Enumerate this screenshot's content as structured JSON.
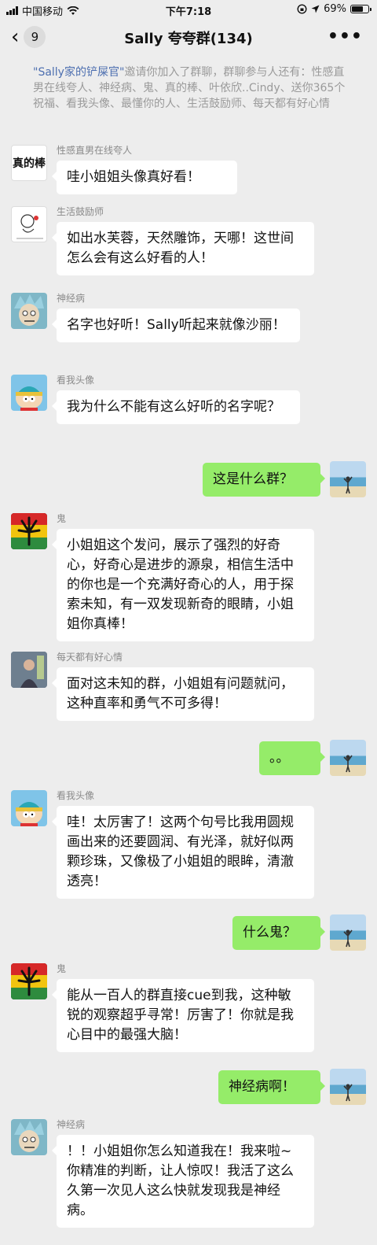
{
  "status_bar": {
    "carrier": "中国移动",
    "time": "下午7:18",
    "battery": "69%",
    "battery_level": 0.69
  },
  "nav": {
    "unread_count": "9",
    "title": "Sally 夸夸群(134)",
    "more": "•••"
  },
  "system_message": {
    "inviter": "\"Sally家的铲屎官\"",
    "text": "邀请你加入了群聊，群聊参与人还有：性感直男在线夸人、神经病、鬼、真的棒、叶依欣..Cindy、送你365个祝福、看我头像、最懂你的人、生活鼓励师、每天都有好心情"
  },
  "messages": [
    {
      "dir": "in",
      "sender": "性感直男在线夸人",
      "text": "哇小姐姐头像真好看！",
      "avatar": "true-bang-avatar",
      "avatar_text": "真的棒"
    },
    {
      "dir": "in",
      "sender": "生活鼓励师",
      "text": "如出水芙蓉，天然雕饰，天哪！这世间怎么会有这么好看的人！",
      "avatar": "sketch-avatar"
    },
    {
      "dir": "in",
      "sender": "神经病",
      "text": "名字也好听！Sally听起来就像沙丽！",
      "avatar": "rick-avatar"
    },
    {
      "dir": "in",
      "sender": "看我头像",
      "text": "我为什么不能有这么好听的名字呢？",
      "avatar": "cartman-avatar"
    },
    {
      "dir": "out",
      "text": "这是什么群？",
      "avatar": "beach-avatar"
    },
    {
      "dir": "in",
      "sender": "鬼",
      "text": "小姐姐这个发问，展示了强烈的好奇心，好奇心是进步的源泉，相信生活中的你也是一个充满好奇心的人，用于探索未知，有一双发现新奇的眼睛，小姐姐你真棒！",
      "avatar": "weed-avatar"
    },
    {
      "dir": "in",
      "sender": "每天都有好心情",
      "text": "面对这未知的群，小姐姐有问题就问，这种直率和勇气不可多得！",
      "avatar": "photo-avatar"
    },
    {
      "dir": "out",
      "text": "。。",
      "avatar": "beach-avatar"
    },
    {
      "dir": "in",
      "sender": "看我头像",
      "text": "哇！太厉害了！这两个句号比我用圆规画出来的还要圆润、有光泽，就好似两颗珍珠，又像极了小姐姐的眼眸，清澈透亮！",
      "avatar": "cartman-avatar"
    },
    {
      "dir": "out",
      "text": "什么鬼？",
      "avatar": "beach-avatar"
    },
    {
      "dir": "in",
      "sender": "鬼",
      "text": "能从一百人的群直接cue到我，这种敏锐的观察超乎寻常！厉害了！你就是我心目中的最强大脑！",
      "avatar": "weed-avatar"
    },
    {
      "dir": "out",
      "text": "神经病啊！",
      "avatar": "beach-avatar"
    },
    {
      "dir": "in",
      "sender": "神经病",
      "text": "！！小姐姐你怎么知道我在！我来啦~你精准的判断，让人惊叹！我活了这么久第一次见人这么快就发现我是神经病。",
      "avatar": "rick-avatar"
    }
  ],
  "colors": {
    "background": "#ededed",
    "outgoing_bubble": "#95ec69",
    "incoming_bubble": "#ffffff",
    "link": "#4d6fb0"
  }
}
